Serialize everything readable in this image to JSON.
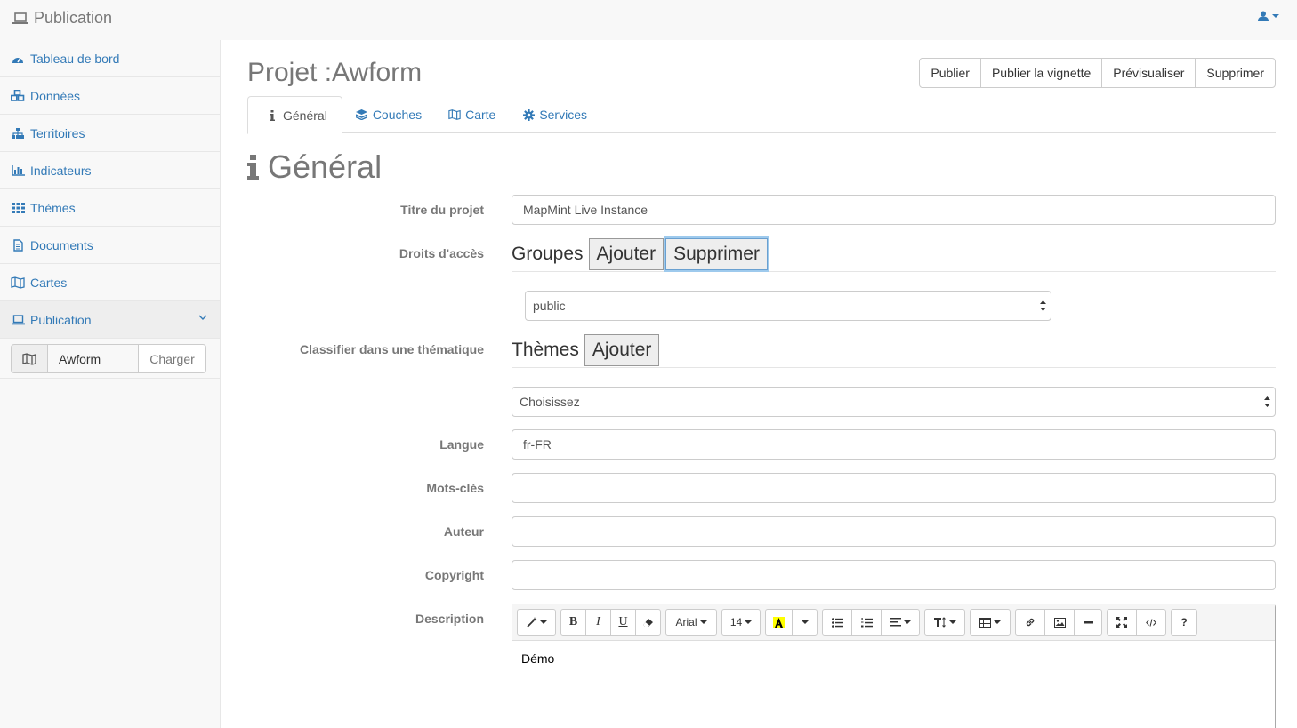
{
  "navbar": {
    "brand": "Publication",
    "user_icon": "user-icon"
  },
  "sidebar": {
    "items": [
      {
        "label": "Tableau de bord",
        "icon": "dashboard-icon"
      },
      {
        "label": "Données",
        "icon": "cubes-icon"
      },
      {
        "label": "Territoires",
        "icon": "sitemap-icon"
      },
      {
        "label": "Indicateurs",
        "icon": "bar-chart-icon"
      },
      {
        "label": "Thèmes",
        "icon": "grid-icon"
      },
      {
        "label": "Documents",
        "icon": "file-icon"
      },
      {
        "label": "Cartes",
        "icon": "map-icon"
      },
      {
        "label": "Publication",
        "icon": "laptop-icon"
      }
    ],
    "loader": {
      "value": "Awform",
      "button": "Charger"
    }
  },
  "main": {
    "title": "Projet :Awform",
    "actions": [
      "Publier",
      "Publier la vignette",
      "Prévisualiser",
      "Supprimer"
    ],
    "tabs": [
      {
        "label": "Général",
        "icon": "info-icon"
      },
      {
        "label": "Couches",
        "icon": "layers-icon"
      },
      {
        "label": "Carte",
        "icon": "map-icon"
      },
      {
        "label": "Services",
        "icon": "gear-icon"
      }
    ],
    "section_title": "Général",
    "form": {
      "titre_label": "Titre du projet",
      "titre_value": "MapMint Live Instance",
      "droits_label": "Droits d'accès",
      "groupes_text": "Groupes",
      "groupes_add": "Ajouter",
      "groupes_remove": "Supprimer",
      "groupes_select": "public",
      "classifier_label": "Classifier dans une thématique",
      "themes_text": "Thèmes",
      "themes_add": "Ajouter",
      "themes_select": "Choisissez",
      "langue_label": "Langue",
      "langue_value": "fr-FR",
      "mots_label": "Mots-clés",
      "mots_value": "",
      "auteur_label": "Auteur",
      "auteur_value": "",
      "copyright_label": "Copyright",
      "copyright_value": "",
      "description_label": "Description",
      "description_value": "Démo"
    },
    "editor_toolbar": {
      "font_name": "Arial",
      "font_size": "14",
      "help": "?"
    }
  }
}
